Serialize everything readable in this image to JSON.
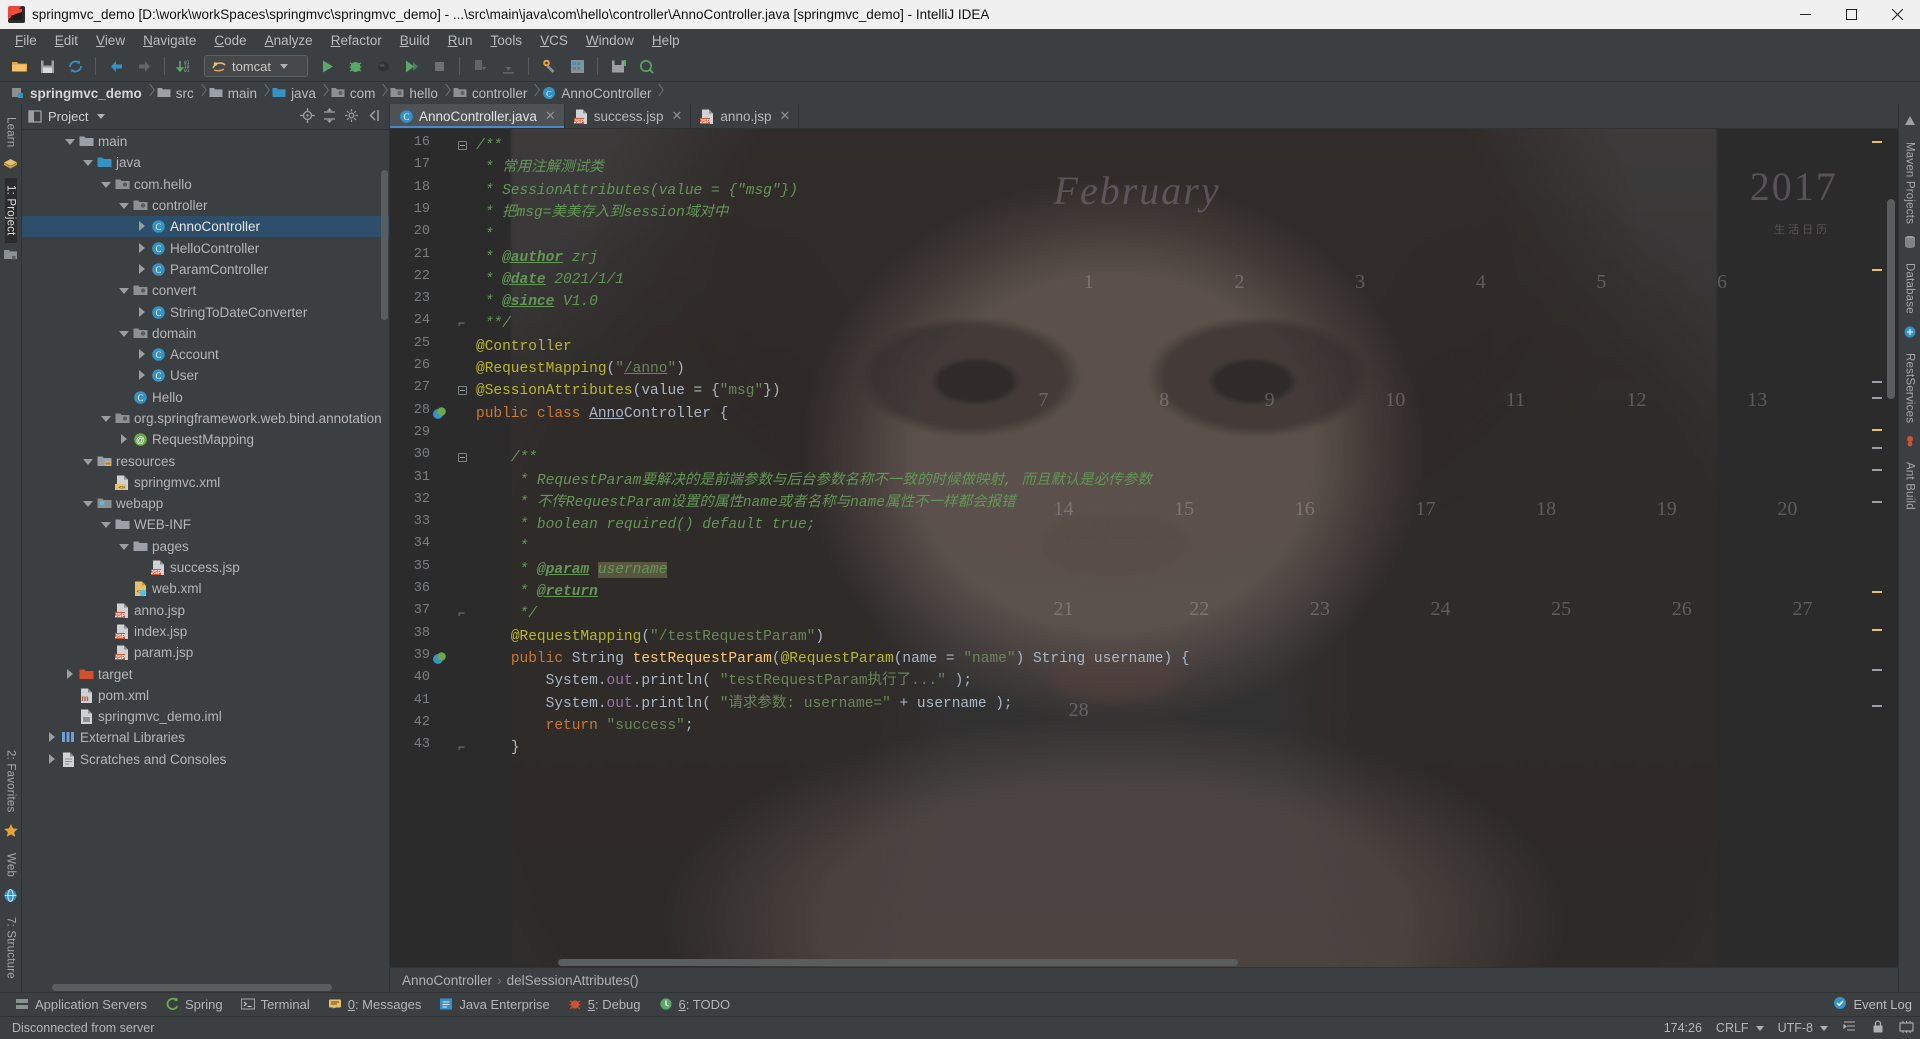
{
  "window": {
    "title": "springmvc_demo [D:\\work\\workSpaces\\springmvc\\springmvc_demo] - ...\\src\\main\\java\\com\\hello\\controller\\AnnoController.java [springmvc_demo] - IntelliJ IDEA",
    "minimize": "—",
    "maximize": "❐",
    "close": "✕"
  },
  "menu": [
    "File",
    "Edit",
    "View",
    "Navigate",
    "Code",
    "Analyze",
    "Refactor",
    "Build",
    "Run",
    "Tools",
    "VCS",
    "Window",
    "Help"
  ],
  "toolbar": {
    "run_config": "tomcat",
    "buttons": [
      "open-project",
      "save-all",
      "sync",
      "back",
      "forward",
      "compile",
      "run",
      "debug",
      "run-coverage",
      "profile",
      "stop",
      "update-project",
      "commit",
      "settings",
      "project-structure",
      "save-icon",
      "search-everywhere"
    ]
  },
  "breadcrumb": [
    {
      "label": "springmvc_demo",
      "icon": "module-icon"
    },
    {
      "label": "src",
      "icon": "folder-icon"
    },
    {
      "label": "main",
      "icon": "folder-icon"
    },
    {
      "label": "java",
      "icon": "source-folder-icon"
    },
    {
      "label": "com",
      "icon": "package-icon"
    },
    {
      "label": "hello",
      "icon": "package-icon"
    },
    {
      "label": "controller",
      "icon": "package-icon"
    },
    {
      "label": "AnnoController",
      "icon": "class-icon"
    }
  ],
  "left_rail": [
    {
      "label": "Learn",
      "active": false
    },
    {
      "label": "1: Project",
      "active": true
    },
    {
      "label": "2: Favorites",
      "active": false
    },
    {
      "label": "Web",
      "active": false
    },
    {
      "label": "7: Structure",
      "active": false
    }
  ],
  "right_rail": [
    {
      "label": "Maven Projects",
      "active": false
    },
    {
      "label": "Database",
      "active": false
    },
    {
      "label": "RestServices",
      "active": false
    },
    {
      "label": "Ant Build",
      "active": false
    }
  ],
  "project_panel": {
    "title": "Project",
    "tree": [
      {
        "label": "main",
        "icon": "folder-icon",
        "indent": 2,
        "twist": "down",
        "selected": false
      },
      {
        "label": "java",
        "icon": "source-folder-icon",
        "indent": 3,
        "twist": "down",
        "selected": false
      },
      {
        "label": "com.hello",
        "icon": "package-icon",
        "indent": 4,
        "twist": "down",
        "selected": false
      },
      {
        "label": "controller",
        "icon": "package-icon",
        "indent": 5,
        "twist": "down",
        "selected": false
      },
      {
        "label": "AnnoController",
        "icon": "class-icon",
        "indent": 6,
        "twist": "right",
        "selected": true
      },
      {
        "label": "HelloController",
        "icon": "class-icon",
        "indent": 6,
        "twist": "right",
        "selected": false
      },
      {
        "label": "ParamController",
        "icon": "class-icon",
        "indent": 6,
        "twist": "right",
        "selected": false
      },
      {
        "label": "convert",
        "icon": "package-icon",
        "indent": 5,
        "twist": "down",
        "selected": false
      },
      {
        "label": "StringToDateConverter",
        "icon": "class-icon",
        "indent": 6,
        "twist": "right",
        "selected": false
      },
      {
        "label": "domain",
        "icon": "package-icon",
        "indent": 5,
        "twist": "down",
        "selected": false
      },
      {
        "label": "Account",
        "icon": "class-icon",
        "indent": 6,
        "twist": "right",
        "selected": false
      },
      {
        "label": "User",
        "icon": "class-icon",
        "indent": 6,
        "twist": "right",
        "selected": false
      },
      {
        "label": "Hello",
        "icon": "class-icon",
        "indent": 5,
        "twist": "none",
        "selected": false
      },
      {
        "label": "org.springframework.web.bind.annotation",
        "icon": "package-icon",
        "indent": 4,
        "twist": "down",
        "selected": false
      },
      {
        "label": "RequestMapping",
        "icon": "annotation-icon",
        "indent": 5,
        "twist": "right",
        "selected": false
      },
      {
        "label": "resources",
        "icon": "resource-folder-icon",
        "indent": 3,
        "twist": "down",
        "selected": false
      },
      {
        "label": "springmvc.xml",
        "icon": "xml-file-icon",
        "indent": 4,
        "twist": "none",
        "selected": false
      },
      {
        "label": "webapp",
        "icon": "web-folder-icon",
        "indent": 3,
        "twist": "down",
        "selected": false
      },
      {
        "label": "WEB-INF",
        "icon": "folder-icon",
        "indent": 4,
        "twist": "down",
        "selected": false
      },
      {
        "label": "pages",
        "icon": "folder-icon",
        "indent": 5,
        "twist": "down",
        "selected": false
      },
      {
        "label": "success.jsp",
        "icon": "jsp-file-icon",
        "indent": 6,
        "twist": "none",
        "selected": false
      },
      {
        "label": "web.xml",
        "icon": "webxml-file-icon",
        "indent": 5,
        "twist": "none",
        "selected": false
      },
      {
        "label": "anno.jsp",
        "icon": "jsp-file-icon",
        "indent": 4,
        "twist": "none",
        "selected": false
      },
      {
        "label": "index.jsp",
        "icon": "jsp-file-icon",
        "indent": 4,
        "twist": "none",
        "selected": false
      },
      {
        "label": "param.jsp",
        "icon": "jsp-file-icon",
        "indent": 4,
        "twist": "none",
        "selected": false
      },
      {
        "label": "target",
        "icon": "excluded-folder-icon",
        "indent": 2,
        "twist": "right",
        "selected": false
      },
      {
        "label": "pom.xml",
        "icon": "maven-file-icon",
        "indent": 2,
        "twist": "none",
        "selected": false
      },
      {
        "label": "springmvc_demo.iml",
        "icon": "iml-file-icon",
        "indent": 2,
        "twist": "none",
        "selected": false
      },
      {
        "label": "External Libraries",
        "icon": "libraries-icon",
        "indent": 1,
        "twist": "right",
        "selected": false
      },
      {
        "label": "Scratches and Consoles",
        "icon": "scratches-icon",
        "indent": 1,
        "twist": "right",
        "selected": false
      }
    ]
  },
  "tabs": [
    {
      "label": "AnnoController.java",
      "icon": "class-icon",
      "active": true,
      "close": "✕"
    },
    {
      "label": "success.jsp",
      "icon": "jsp-file-icon",
      "active": false,
      "close": "✕"
    },
    {
      "label": "anno.jsp",
      "icon": "jsp-file-icon",
      "active": false,
      "close": "✕"
    }
  ],
  "editor": {
    "first_line": 16,
    "line_numbers": [
      16,
      17,
      18,
      19,
      20,
      21,
      22,
      23,
      24,
      25,
      26,
      27,
      28,
      29,
      30,
      31,
      32,
      33,
      34,
      35,
      36,
      37,
      38,
      39,
      40,
      41,
      42,
      43
    ],
    "code_lines": [
      {
        "n": 16,
        "html": "<span class=\"c\">/**</span>"
      },
      {
        "n": 17,
        "html": "<span class=\"c\"> * 常用注解测试类</span>"
      },
      {
        "n": 18,
        "html": "<span class=\"c\"> * SessionAttributes(value = {\"msg\"})</span>"
      },
      {
        "n": 19,
        "html": "<span class=\"c\"> * 把msg=美美存入到session域对中</span>"
      },
      {
        "n": 20,
        "html": "<span class=\"c\"> *</span>"
      },
      {
        "n": 21,
        "html": "<span class=\"c\"> * </span><span class=\"tag ul\">@author</span><span class=\"c\"> zrj</span>"
      },
      {
        "n": 22,
        "html": "<span class=\"c\"> * </span><span class=\"tag ul\">@date</span><span class=\"c\"> 2021/1/1</span>"
      },
      {
        "n": 23,
        "html": "<span class=\"c\"> * </span><span class=\"tag ul\">@since</span><span class=\"c\"> V1.0</span>"
      },
      {
        "n": 24,
        "html": "<span class=\"c\"> **/</span>"
      },
      {
        "n": 25,
        "html": "<span class=\"an\">@Controller</span>"
      },
      {
        "n": 26,
        "html": "<span class=\"an\">@RequestMapping</span><span class=\"ty\">(</span><span class=\"s\">\"<span class=\"ul\">/anno</span>\"</span><span class=\"ty\">)</span>"
      },
      {
        "n": 27,
        "html": "<span class=\"an\">@SessionAttributes</span><span class=\"ty\">(value = {</span><span class=\"s\">\"msg\"</span><span class=\"ty\">})</span>"
      },
      {
        "n": 28,
        "html": "<span class=\"k\">public class </span><span class=\"ty\"><span class=\"ul\">Anno</span>Controller {</span>"
      },
      {
        "n": 29,
        "html": ""
      },
      {
        "n": 30,
        "html": "    <span class=\"c\">/**</span>"
      },
      {
        "n": 31,
        "html": "     <span class=\"c\">* RequestParam要解决的是前端参数与后台参数名称不一致的时候做映射, 而且默认是必传参数</span>"
      },
      {
        "n": 32,
        "html": "     <span class=\"c\">* 不传RequestParam设置的属性name或者名称与name属性不一样都会报错</span>"
      },
      {
        "n": 33,
        "html": "     <span class=\"c\">* boolean required() default true;</span>"
      },
      {
        "n": 34,
        "html": "     <span class=\"c\">*</span>"
      },
      {
        "n": 35,
        "html": "     <span class=\"c\">* </span><span class=\"tag ul\">@param</span><span class=\"c\"> </span><span class=\"hl c\">username</span>"
      },
      {
        "n": 36,
        "html": "     <span class=\"c\">* </span><span class=\"tag ul\">@return</span>"
      },
      {
        "n": 37,
        "html": "     <span class=\"c\">*/</span>"
      },
      {
        "n": 38,
        "html": "    <span class=\"an\">@RequestMapping</span><span class=\"ty\">(</span><span class=\"s\">\"/testRequestParam\"</span><span class=\"ty\">)</span>"
      },
      {
        "n": 39,
        "html": "    <span class=\"k\">public </span><span class=\"ty\">String </span><span class=\"fn\">testRequestParam</span><span class=\"ty\">(</span><span class=\"an\">@RequestParam</span><span class=\"ty\">(name = </span><span class=\"s\">\"name\"</span><span class=\"ty\">) String username) {</span>"
      },
      {
        "n": 40,
        "html": "        <span class=\"ty\">System.</span><span class=\"fl\">out</span><span class=\"ty\">.</span><span class=\"ty\">println(</span> <span class=\"s\">\"testRequestParam执行了...\"</span> <span class=\"ty\">);</span>"
      },
      {
        "n": 41,
        "html": "        <span class=\"ty\">System.</span><span class=\"fl\">out</span><span class=\"ty\">.println(</span> <span class=\"s\">\"请求参数: username=\"</span> <span class=\"ty\">+ username );</span>"
      },
      {
        "n": 42,
        "html": "        <span class=\"k\">return </span><span class=\"s\">\"success\"</span><span class=\"ty\">;</span>"
      },
      {
        "n": 43,
        "html": "    <span class=\"ty\">}</span>"
      }
    ],
    "wallpaper": {
      "month": "February",
      "year": "2017",
      "year_sub": "生活日历",
      "calendar_numbers": [
        "1",
        "2",
        "3",
        "4",
        "5",
        "6",
        "7",
        "8",
        "9",
        "10",
        "11",
        "12",
        "13",
        "14",
        "15",
        "16",
        "17",
        "18",
        "19",
        "20",
        "21",
        "22",
        "23",
        "24",
        "25",
        "26",
        "27",
        "28"
      ]
    }
  },
  "editor_breadcrumb": {
    "class": "AnnoController",
    "separator": "›",
    "method": "delSessionAttributes()"
  },
  "bottom_bar": {
    "items": [
      {
        "label": "Application Servers",
        "icon": "server-icon"
      },
      {
        "label": "Spring",
        "icon": "spring-icon"
      },
      {
        "label": "Terminal",
        "icon": "terminal-icon"
      },
      {
        "label": "0: Messages",
        "icon": "messages-icon"
      },
      {
        "label": "Java Enterprise",
        "icon": "javaee-icon"
      },
      {
        "label": "5: Debug",
        "icon": "debug-icon"
      },
      {
        "label": "6: TODO",
        "icon": "todo-icon"
      }
    ],
    "event_log": "Event Log"
  },
  "status_bar": {
    "message": "Disconnected from server",
    "caret": "174:26",
    "line_sep": "CRLF",
    "encoding": "UTF-8",
    "indent_icon": "indent-icon",
    "lock_icon": "lock-icon",
    "memory_icon": "memory-icon"
  },
  "colors": {
    "accent": "#4a88c7",
    "selection": "#2d4f6b",
    "panel_bg": "#3c3f41",
    "editor_bg": "#2b2b2b",
    "keyword": "#cc7832",
    "string": "#6a8759",
    "comment": "#629755",
    "annotation": "#bbb529",
    "method": "#ffc66d",
    "field": "#9876aa"
  }
}
